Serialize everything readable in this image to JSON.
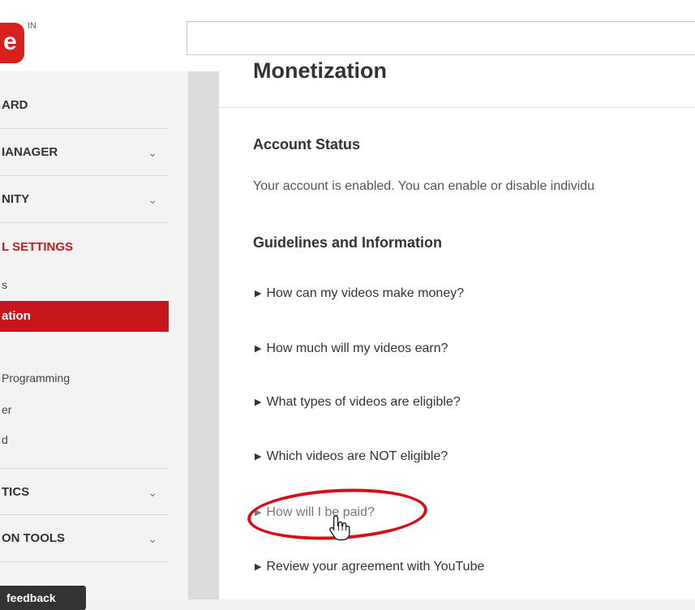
{
  "header": {
    "logo_text": "e",
    "region_badge": "IN",
    "search": {
      "value": "",
      "placeholder": ""
    }
  },
  "sidebar": {
    "items": [
      {
        "label": "ARD",
        "has_chevron": false
      },
      {
        "label": "IANAGER",
        "has_chevron": true
      },
      {
        "label": "NITY",
        "has_chevron": true
      },
      {
        "label": "L SETTINGS",
        "has_chevron": false
      },
      {
        "label": "TICS",
        "has_chevron": true
      },
      {
        "label": "ON TOOLS",
        "has_chevron": true
      }
    ],
    "sub_items": [
      {
        "label": "s"
      },
      {
        "label": "ation",
        "active": true
      },
      {
        "label": "Programming"
      },
      {
        "label": "er"
      },
      {
        "label": "d"
      }
    ],
    "feedback_label": "feedback",
    "accent_color": "#cc181e"
  },
  "main": {
    "page_title": "Monetization",
    "account_status": {
      "heading": "Account Status",
      "text": "Your account is enabled. You can enable or disable individu"
    },
    "guidelines": {
      "heading": "Guidelines and Information",
      "items": [
        "How can my videos make money?",
        "How much will my videos earn?",
        "What types of videos are eligible?",
        "Which videos are NOT eligible?",
        "How will I be paid?",
        "Review your agreement with YouTube"
      ]
    },
    "highlight_color": "#d40f18"
  },
  "icons": {
    "chevron": "chevron-down-icon",
    "expand": "triangle-right-icon",
    "cursor": "hand-pointer-icon"
  }
}
